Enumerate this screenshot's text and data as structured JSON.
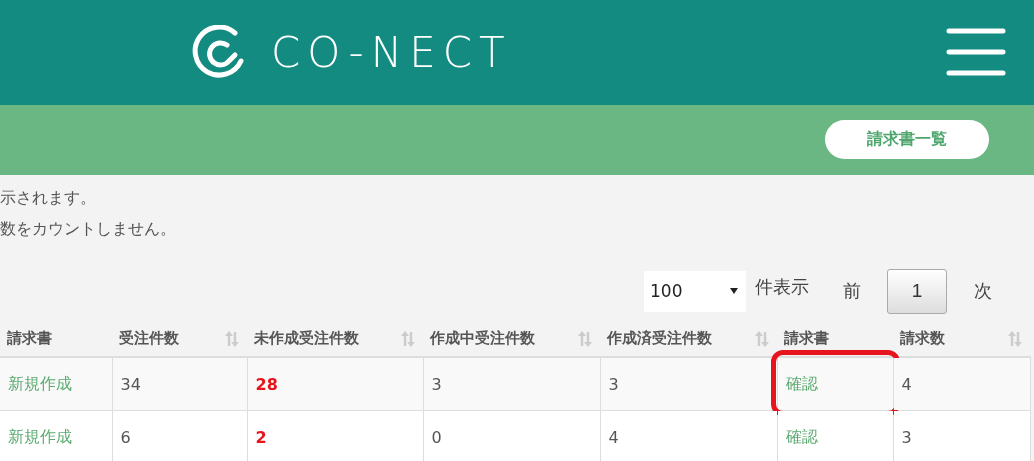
{
  "header": {
    "logo": "CO-NECT"
  },
  "toolbar": {
    "button": "請求書一覧"
  },
  "notices": [
    "示されます。",
    "数をカウントしません。"
  ],
  "pagination": {
    "page_size": "100",
    "page_size_suffix": "件表示",
    "prev": "前",
    "pages": [
      {
        "label": "1",
        "selected": true
      }
    ],
    "next": "次"
  },
  "table": {
    "columns": [
      {
        "label": "請求書",
        "sortable": false
      },
      {
        "label": "受注件数",
        "sortable": true
      },
      {
        "label": "未作成受注件数",
        "sortable": true
      },
      {
        "label": "作成中受注件数",
        "sortable": true
      },
      {
        "label": "作成済受注件数",
        "sortable": true
      },
      {
        "label": "請求書",
        "sortable": false
      },
      {
        "label": "請求数",
        "sortable": true
      }
    ],
    "rows": [
      {
        "cells": [
          {
            "kind": "link",
            "text": "新規作成"
          },
          {
            "kind": "plain",
            "text": "34"
          },
          {
            "kind": "alert",
            "text": "28"
          },
          {
            "kind": "plain",
            "text": "3"
          },
          {
            "kind": "plain",
            "text": "3"
          },
          {
            "kind": "link",
            "text": "確認",
            "highlighted": true
          },
          {
            "kind": "plain",
            "text": "4"
          }
        ]
      },
      {
        "cells": [
          {
            "kind": "link",
            "text": "新規作成"
          },
          {
            "kind": "plain",
            "text": "6"
          },
          {
            "kind": "alert",
            "text": "2"
          },
          {
            "kind": "plain",
            "text": "0"
          },
          {
            "kind": "plain",
            "text": "4"
          },
          {
            "kind": "link",
            "text": "確認",
            "highlighted": false
          },
          {
            "kind": "plain",
            "text": "3"
          }
        ]
      }
    ]
  }
}
